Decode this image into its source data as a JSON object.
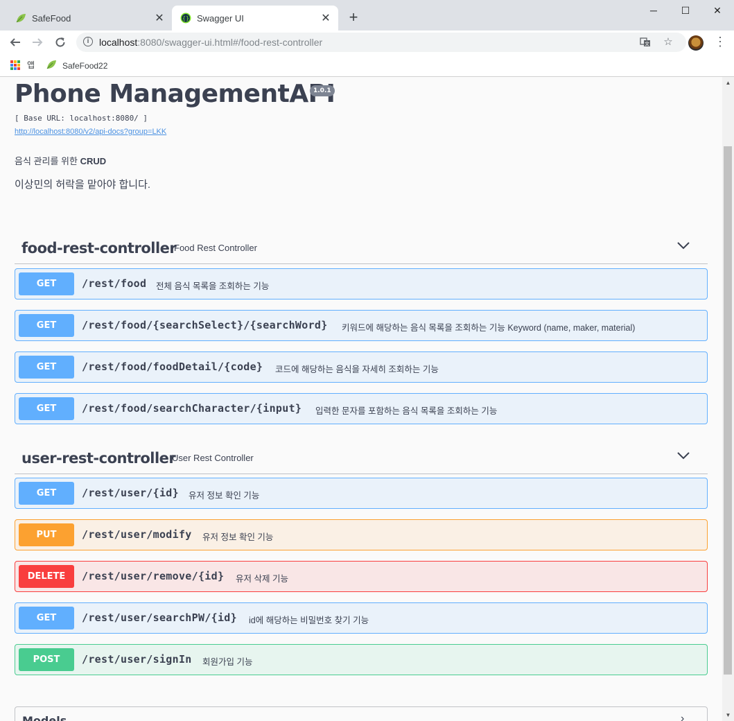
{
  "browser": {
    "tabs": [
      {
        "label": "SafeFood",
        "icon": "leaf-icon"
      },
      {
        "label": "Swagger UI",
        "icon": "swagger-icon"
      }
    ],
    "new_tab": "+",
    "window": {
      "minimize": "─",
      "maximize": "☐",
      "close": "✕"
    },
    "url_host": "localhost",
    "url_rest": ":8080/swagger-ui.html#/food-rest-controller",
    "bookmarks": [
      {
        "label": "앱",
        "icon": "apps-grid-icon"
      },
      {
        "label": "SafeFood22",
        "icon": "leaf-icon"
      }
    ]
  },
  "info": {
    "title": "Phone ManagementAPI",
    "version": "1.0.1",
    "base_url": "[ Base URL: localhost:8080/ ]",
    "docs_link": "http://localhost:8080/v2/api-docs?group=LKK",
    "desc_prefix": "음식 관리를 위한 ",
    "desc_bold": "CRUD",
    "desc2": "이상민의 허락을 맡아야 합니다."
  },
  "sections": [
    {
      "name": "food-rest-controller",
      "description": "Food Rest Controller",
      "operations": [
        {
          "method": "GET",
          "path": "/rest/food",
          "summary": "전체 음식 목록을 조회하는 기능"
        },
        {
          "method": "GET",
          "path": "/rest/food/{searchSelect}/{searchWord}",
          "summary": "키워드에 해당하는 음식 목록을 조회하는 기능 Keyword (name, maker, material)"
        },
        {
          "method": "GET",
          "path": "/rest/food/foodDetail/{code}",
          "summary": "코드에 해당하는 음식을 자세히 조회하는 기능"
        },
        {
          "method": "GET",
          "path": "/rest/food/searchCharacter/{input}",
          "summary": "입력한 문자를 포함하는 음식 목록을 조회하는 기능"
        }
      ]
    },
    {
      "name": "user-rest-controller",
      "description": "User Rest Controller",
      "operations": [
        {
          "method": "GET",
          "path": "/rest/user/{id}",
          "summary": "유저 정보 확인 기능"
        },
        {
          "method": "PUT",
          "path": "/rest/user/modify",
          "summary": "유저 정보 확인 기능"
        },
        {
          "method": "DELETE",
          "path": "/rest/user/remove/{id}",
          "summary": "유저 삭제 기능"
        },
        {
          "method": "GET",
          "path": "/rest/user/searchPW/{id}",
          "summary": "id에 해당하는 비밀번호 찾기 기능"
        },
        {
          "method": "POST",
          "path": "/rest/user/signIn",
          "summary": "회원가입 기능"
        }
      ]
    }
  ],
  "models": {
    "title": "Models",
    "arrow": "›"
  },
  "colors": {
    "get": "#61affe",
    "put": "#fca130",
    "delete": "#f93e3e",
    "post": "#49cc90",
    "text": "#3b4151"
  }
}
